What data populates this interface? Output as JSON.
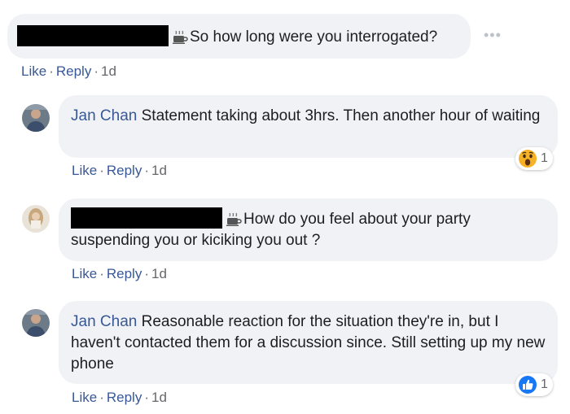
{
  "comments": [
    {
      "author": "",
      "text": "So how long were you interrogated?",
      "actions": {
        "like": "Like",
        "reply": "Reply",
        "time": "1d"
      },
      "more_label": "..."
    },
    {
      "author": "Jan Chan",
      "text": "Statement taking about 3hrs. Then another hour of waiting",
      "actions": {
        "like": "Like",
        "reply": "Reply",
        "time": "1d"
      },
      "reaction": {
        "icon": "wow-emoji-icon",
        "count": "1"
      }
    },
    {
      "author": "",
      "text": "How do you feel about your party suspending you or kiciking you out ?",
      "actions": {
        "like": "Like",
        "reply": "Reply",
        "time": "1d"
      }
    },
    {
      "author": "Jan Chan",
      "text": "Reasonable reaction for the situation they're in, but I haven't contacted them for a discussion since. Still setting up my new phone",
      "actions": {
        "like": "Like",
        "reply": "Reply",
        "time": "1d"
      },
      "reaction": {
        "icon": "thumbs-up-icon",
        "count": "1",
        "color": "#1877f2"
      }
    }
  ],
  "separator": "·",
  "colors": {
    "link": "#385898",
    "bubble": "#f0f2f5",
    "meta": "#65676b",
    "like_blue": "#1877f2"
  }
}
